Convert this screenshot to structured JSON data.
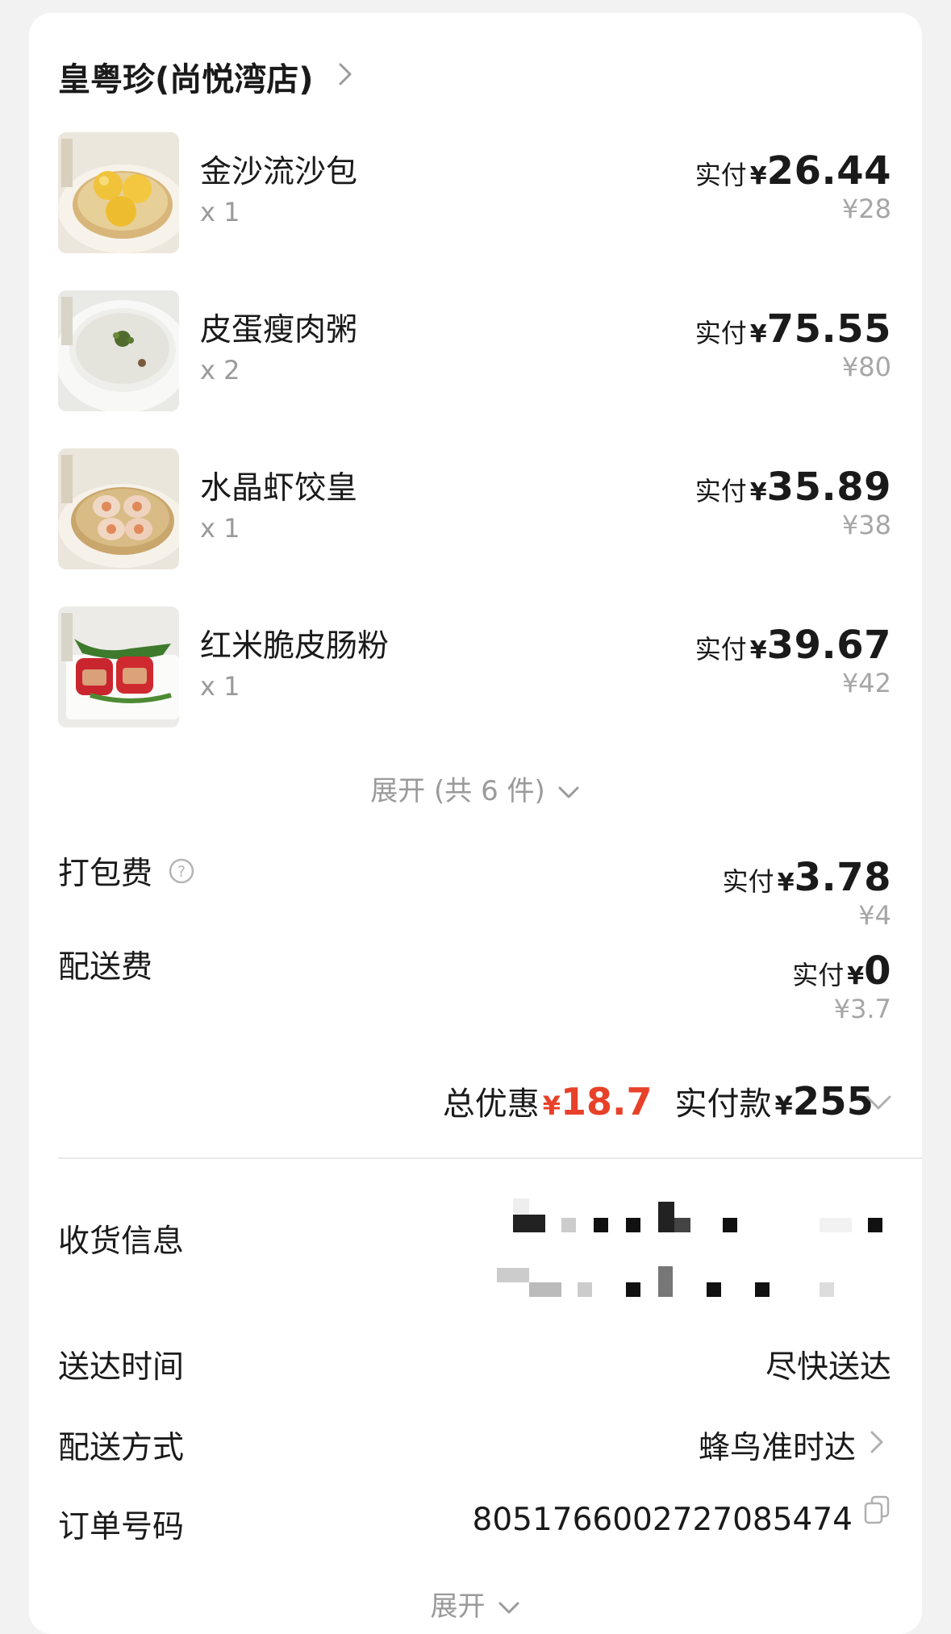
{
  "store": {
    "name": "皇粤珍(尚悦湾店)"
  },
  "items": [
    {
      "name": "金沙流沙包",
      "qty": "x 1",
      "pay_label": "实付",
      "currency": "¥",
      "pay": "26.44",
      "original": "¥28",
      "image": "steamed-custard-buns"
    },
    {
      "name": "皮蛋瘦肉粥",
      "qty": "x 2",
      "pay_label": "实付",
      "currency": "¥",
      "pay": "75.55",
      "original": "¥80",
      "image": "congee-bowl"
    },
    {
      "name": "水晶虾饺皇",
      "qty": "x 1",
      "pay_label": "实付",
      "currency": "¥",
      "pay": "35.89",
      "original": "¥38",
      "image": "shrimp-dumplings"
    },
    {
      "name": "红米脆皮肠粉",
      "qty": "x 1",
      "pay_label": "实付",
      "currency": "¥",
      "pay": "39.67",
      "original": "¥42",
      "image": "red-rice-rolls"
    }
  ],
  "expand_items": "展开 (共 6 件)",
  "fees": [
    {
      "label": "打包费",
      "pay_label": "实付",
      "currency": "¥",
      "pay": "3.78",
      "original": "¥4",
      "icon": "help-circle-icon"
    },
    {
      "label": "配送费",
      "pay_label": "实付",
      "currency": "¥",
      "pay": "0",
      "original": "¥3.7"
    }
  ],
  "summary": {
    "discount_label": "总优惠",
    "discount_currency": "¥",
    "discount_value": "18.7",
    "total_label": "实付款",
    "total_currency": "¥",
    "total_value": "255"
  },
  "details": {
    "address_label": "收货信息",
    "time_label": "送达时间",
    "time_value": "尽快送达",
    "method_label": "配送方式",
    "method_value": "蜂鸟准时达",
    "order_label": "订单号码",
    "order_value": "8051766002727085474"
  },
  "expand_detail": "展开",
  "colors": {
    "accent_red": "#e8412a",
    "muted": "#9a9a9a",
    "card": "#ffffff",
    "background": "#f2f2f2"
  }
}
